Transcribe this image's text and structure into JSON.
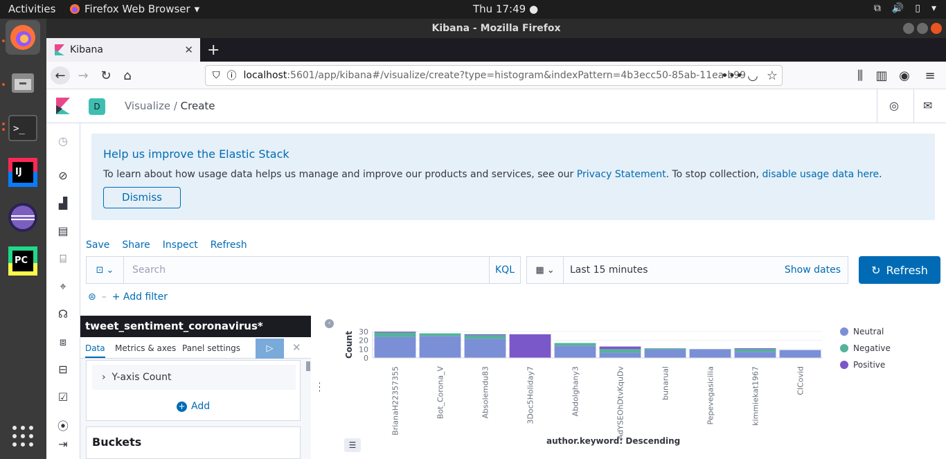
{
  "os": {
    "activities": "Activities",
    "app_menu": "Firefox Web Browser",
    "clock": "Thu 17:49"
  },
  "window": {
    "title": "Kibana - Mozilla Firefox"
  },
  "browser": {
    "tab_title": "Kibana",
    "url_host": "localhost",
    "url_rest": ":5601/app/kibana#/visualize/create?type=histogram&indexPattern=4b3ecc50-85ab-11ea-b99"
  },
  "kibana": {
    "space_letter": "D",
    "breadcrumb": {
      "parent": "Visualize",
      "current": "Create"
    },
    "callout": {
      "title": "Help us improve the Elastic Stack",
      "text_before": "To learn about how usage data helps us manage and improve our products and services, see our ",
      "privacy_link": "Privacy Statement",
      "text_middle": ". To stop collection, ",
      "disable_link": "disable usage data here",
      "text_after": ".",
      "dismiss": "Dismiss"
    },
    "top_nav": {
      "save": "Save",
      "share": "Share",
      "inspect": "Inspect",
      "refresh": "Refresh"
    },
    "query": {
      "placeholder": "Search",
      "language": "KQL"
    },
    "time": {
      "range": "Last 15 minutes",
      "show_dates": "Show dates",
      "refresh_button": "Refresh"
    },
    "filter": {
      "add_filter": "+ Add filter"
    },
    "editor": {
      "index_title": "tweet_sentiment_coronavirus*",
      "tabs": [
        "Data",
        "Metrics & axes",
        "Panel settings"
      ],
      "yaxis_label": "Y-axis Count",
      "add_label": "Add",
      "buckets_title": "Buckets"
    }
  },
  "chart_data": {
    "type": "bar",
    "stacked": true,
    "ylabel": "Count",
    "xlabel": "author.keyword: Descending",
    "ylim": [
      0,
      30
    ],
    "yticks": [
      "30",
      "20",
      "10",
      "0"
    ],
    "categories": [
      "BrianaH22357355",
      "Bot_Corona_V",
      "Absolemdu83",
      "3Doc5Holiday7",
      "Abdolghany3",
      "AdYSEOhDtvKquDv",
      "bunarual",
      "Pepevegasicilia",
      "kimmiekat1967",
      "ClCovid"
    ],
    "series": [
      {
        "name": "Neutral",
        "color": "#7b8fd7",
        "values": [
          24,
          25,
          22,
          0,
          14,
          6,
          10,
          10,
          7,
          9
        ]
      },
      {
        "name": "Negative",
        "color": "#54b399",
        "values": [
          5,
          3,
          4,
          0,
          3,
          4,
          1,
          0,
          3,
          0
        ]
      },
      {
        "name": "Positive",
        "color": "#7b58c9",
        "values": [
          1,
          0,
          1,
          27,
          0,
          3,
          0,
          0,
          1,
          0
        ]
      }
    ],
    "legend_position": "right"
  }
}
